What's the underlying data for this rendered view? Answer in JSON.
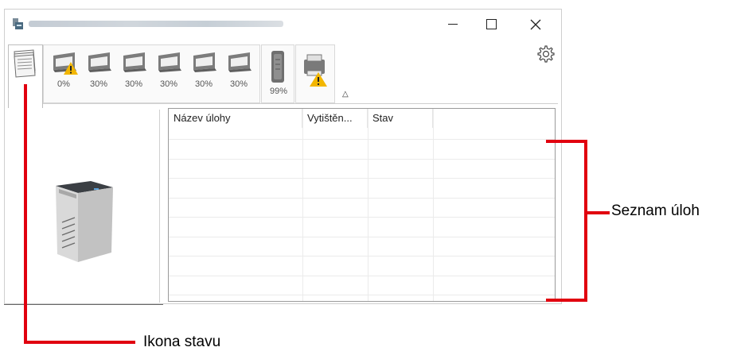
{
  "window": {
    "title_blurred": true
  },
  "titlebar_buttons": {
    "minimize": "minimize",
    "maximize": "maximize",
    "close": "close"
  },
  "trays": [
    {
      "name": "tray-1",
      "level": "0%",
      "warning": true
    },
    {
      "name": "tray-2",
      "level": "30%",
      "warning": false
    },
    {
      "name": "tray-3",
      "level": "30%",
      "warning": false
    },
    {
      "name": "tray-4",
      "level": "30%",
      "warning": false
    },
    {
      "name": "tray-5",
      "level": "30%",
      "warning": false
    },
    {
      "name": "tray-6",
      "level": "30%",
      "warning": false
    }
  ],
  "toner": {
    "level": "99%"
  },
  "job_list": {
    "columns": [
      "Název úlohy",
      "Vytištěn...",
      "Stav"
    ],
    "rows": []
  },
  "callouts": {
    "job_list_label": "Seznam úloh",
    "status_icon_label": "Ikona stavu"
  },
  "colors": {
    "callout": "#e1000f",
    "warning": "#f2b600"
  }
}
